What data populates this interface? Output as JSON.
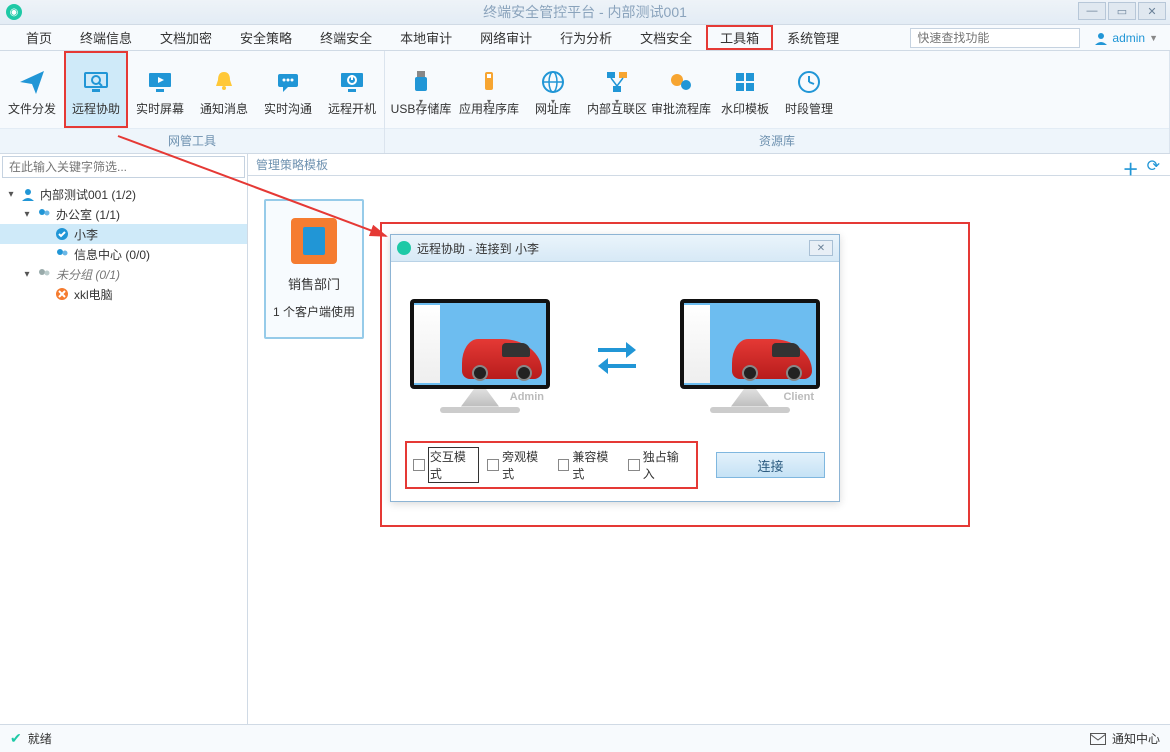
{
  "window": {
    "title": "终端安全管控平台 - 内部测试001"
  },
  "menu": {
    "items": [
      "首页",
      "终端信息",
      "文档加密",
      "安全策略",
      "终端安全",
      "本地审计",
      "网络审计",
      "行为分析",
      "文档安全",
      "工具箱",
      "系统管理"
    ],
    "active_index": 9,
    "search_placeholder": "快速查找功能",
    "user": "admin"
  },
  "ribbon": {
    "group1_label": "网管工具",
    "group2_label": "资源库",
    "group1_items": [
      {
        "label": "文件分发",
        "icon": "paper-plane"
      },
      {
        "label": "远程协助",
        "icon": "monitor-search",
        "highlight": true
      },
      {
        "label": "实时屏幕",
        "icon": "monitor-play"
      },
      {
        "label": "通知消息",
        "icon": "bell"
      },
      {
        "label": "实时沟通",
        "icon": "chat"
      },
      {
        "label": "远程开机",
        "icon": "power"
      }
    ],
    "group2_items": [
      {
        "label": "USB存储库",
        "icon": "usb",
        "caret": true
      },
      {
        "label": "应用程序库",
        "icon": "apps",
        "caret": true
      },
      {
        "label": "网址库",
        "icon": "globe",
        "caret": true
      },
      {
        "label": "内部互联区",
        "icon": "network",
        "caret": true
      },
      {
        "label": "审批流程库",
        "icon": "gears"
      },
      {
        "label": "水印模板",
        "icon": "grid"
      },
      {
        "label": "时段管理",
        "icon": "clock"
      }
    ]
  },
  "sidebar": {
    "filter_placeholder": "在此输入关键字筛选..."
  },
  "tree": [
    {
      "label": "内部测试001 (1/2)",
      "icon": "user-blue",
      "indent": 0,
      "expand": "down"
    },
    {
      "label": "办公室 (1/1)",
      "icon": "users-blue",
      "indent": 1,
      "expand": "down"
    },
    {
      "label": "小李",
      "icon": "check-blue",
      "indent": 2,
      "selected": true
    },
    {
      "label": "信息中心 (0/0)",
      "icon": "users-blue",
      "indent": 2
    },
    {
      "label": "未分组 (0/1)",
      "icon": "users-grey",
      "indent": 1,
      "expand": "down",
      "muted": true
    },
    {
      "label": "xkl电脑",
      "icon": "x-orange",
      "indent": 2
    }
  ],
  "content": {
    "header": "管理策略模板",
    "card_line1": "销售部门",
    "card_line2": "1 个客户端使用"
  },
  "dialog": {
    "title": "远程协助 - 连接到 小李",
    "admin_label": "Admin",
    "client_label": "Client",
    "checks": [
      "交互模式",
      "旁观模式",
      "兼容模式",
      "独占输入"
    ],
    "connect": "连接"
  },
  "status": {
    "ready": "就绪",
    "notify": "通知中心"
  }
}
